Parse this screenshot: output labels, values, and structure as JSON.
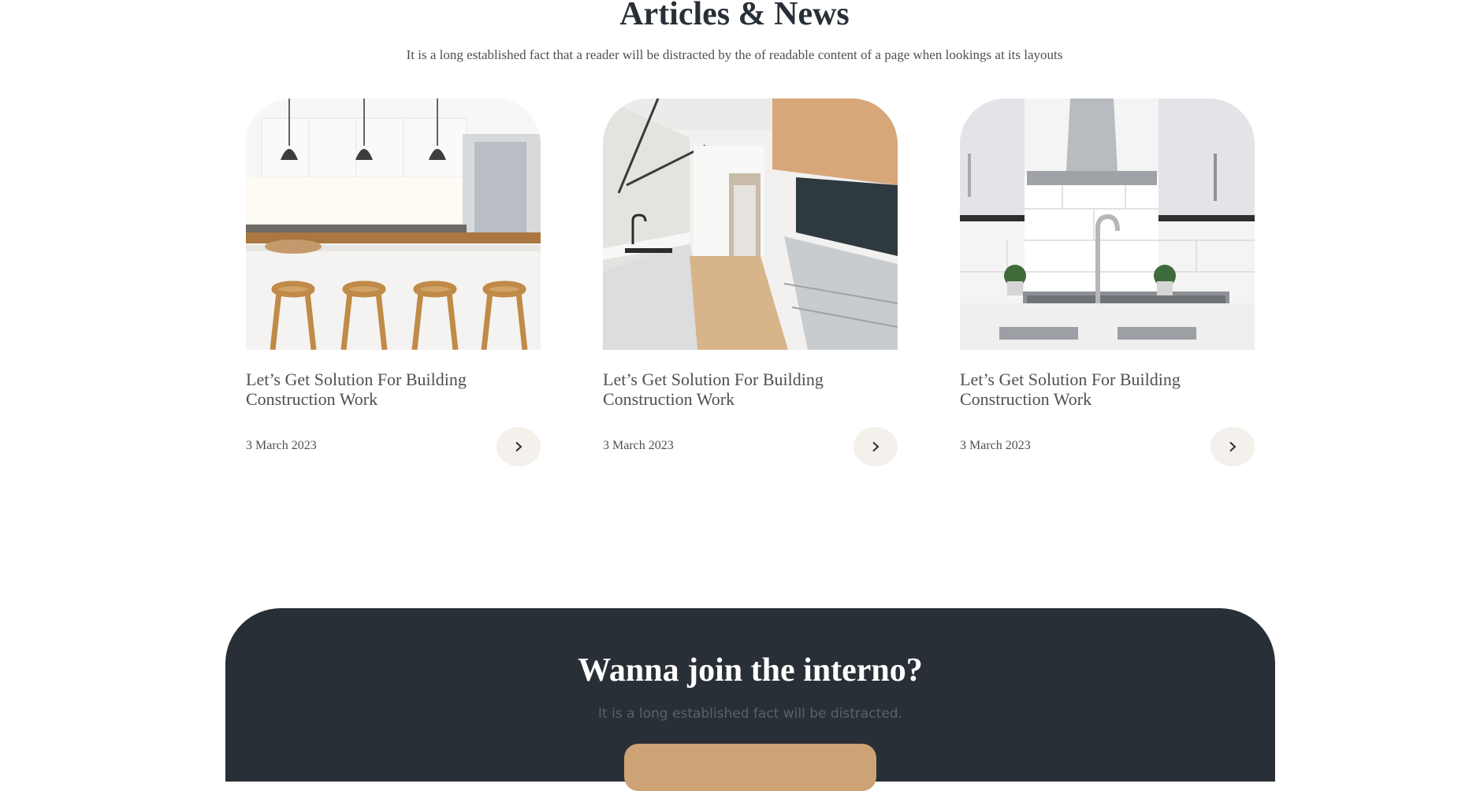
{
  "section": {
    "title": "Articles & News",
    "subtitle": "It is a long established fact that a reader will be distracted by the of readable content of a page when lookings at its layouts"
  },
  "articles": [
    {
      "title": "Let’s Get Solution For Building Construction Work",
      "date": "3 March 2023",
      "image_icon": "kitchen-island-photo",
      "button_icon": "chevron-right-icon"
    },
    {
      "title": "Let’s Get Solution For Building Construction Work",
      "date": "3 March 2023",
      "image_icon": "galley-kitchen-photo",
      "button_icon": "chevron-right-icon"
    },
    {
      "title": "Let’s Get Solution For Building Construction Work",
      "date": "3 March 2023",
      "image_icon": "kitchen-sink-photo",
      "button_icon": "chevron-right-icon"
    }
  ],
  "cta": {
    "title": "Wanna join the interno?",
    "subtitle": "It is a long established fact will be distracted."
  },
  "colors": {
    "heading": "#292F36",
    "text": "#4D5053",
    "button_bg": "#F4F0EC",
    "cta_bg": "#292F36",
    "accent": "#CDA274"
  }
}
